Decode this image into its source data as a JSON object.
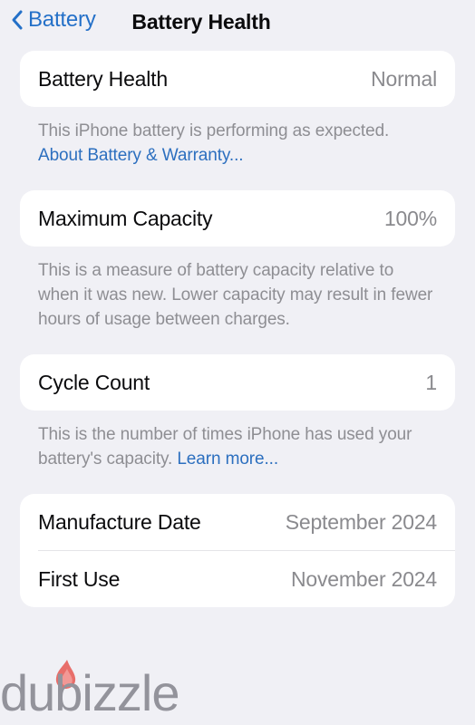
{
  "navbar": {
    "back_label": "Battery",
    "back_icon": "chevron-left-icon",
    "title": "Battery Health"
  },
  "sections": [
    {
      "id": "battery-health",
      "rows": [
        {
          "label": "Battery Health",
          "value": "Normal"
        }
      ],
      "footnote": {
        "text": "This iPhone battery is performing as expected. ",
        "link": "About Battery & Warranty..."
      }
    },
    {
      "id": "maximum-capacity",
      "rows": [
        {
          "label": "Maximum Capacity",
          "value": "100%"
        }
      ],
      "footnote": {
        "text": "This is a measure of battery capacity relative to when it was new. Lower capacity may result in fewer hours of usage between charges.",
        "link": ""
      }
    },
    {
      "id": "cycle-count",
      "rows": [
        {
          "label": "Cycle Count",
          "value": "1"
        }
      ],
      "footnote": {
        "text": "This is the number of times iPhone has used your battery's capacity. ",
        "link": "Learn more..."
      }
    },
    {
      "id": "battery-dates",
      "rows": [
        {
          "label": "Manufacture Date",
          "value": "September 2024"
        },
        {
          "label": "First Use",
          "value": "November 2024"
        }
      ],
      "footnote": null
    }
  ],
  "watermark": {
    "text": "dubizzle",
    "icon": "flame-icon"
  },
  "colors": {
    "background": "#F0F0F5",
    "card": "#FFFFFF",
    "label": "#0B0B0D",
    "value": "#8A8A8E",
    "footnote": "#8E8E93",
    "link": "#2C6FBF",
    "tint": "#2470C8",
    "divider": "#E4E4E8",
    "watermark_text": "#8C8C94",
    "watermark_flame": "#E8635F"
  }
}
